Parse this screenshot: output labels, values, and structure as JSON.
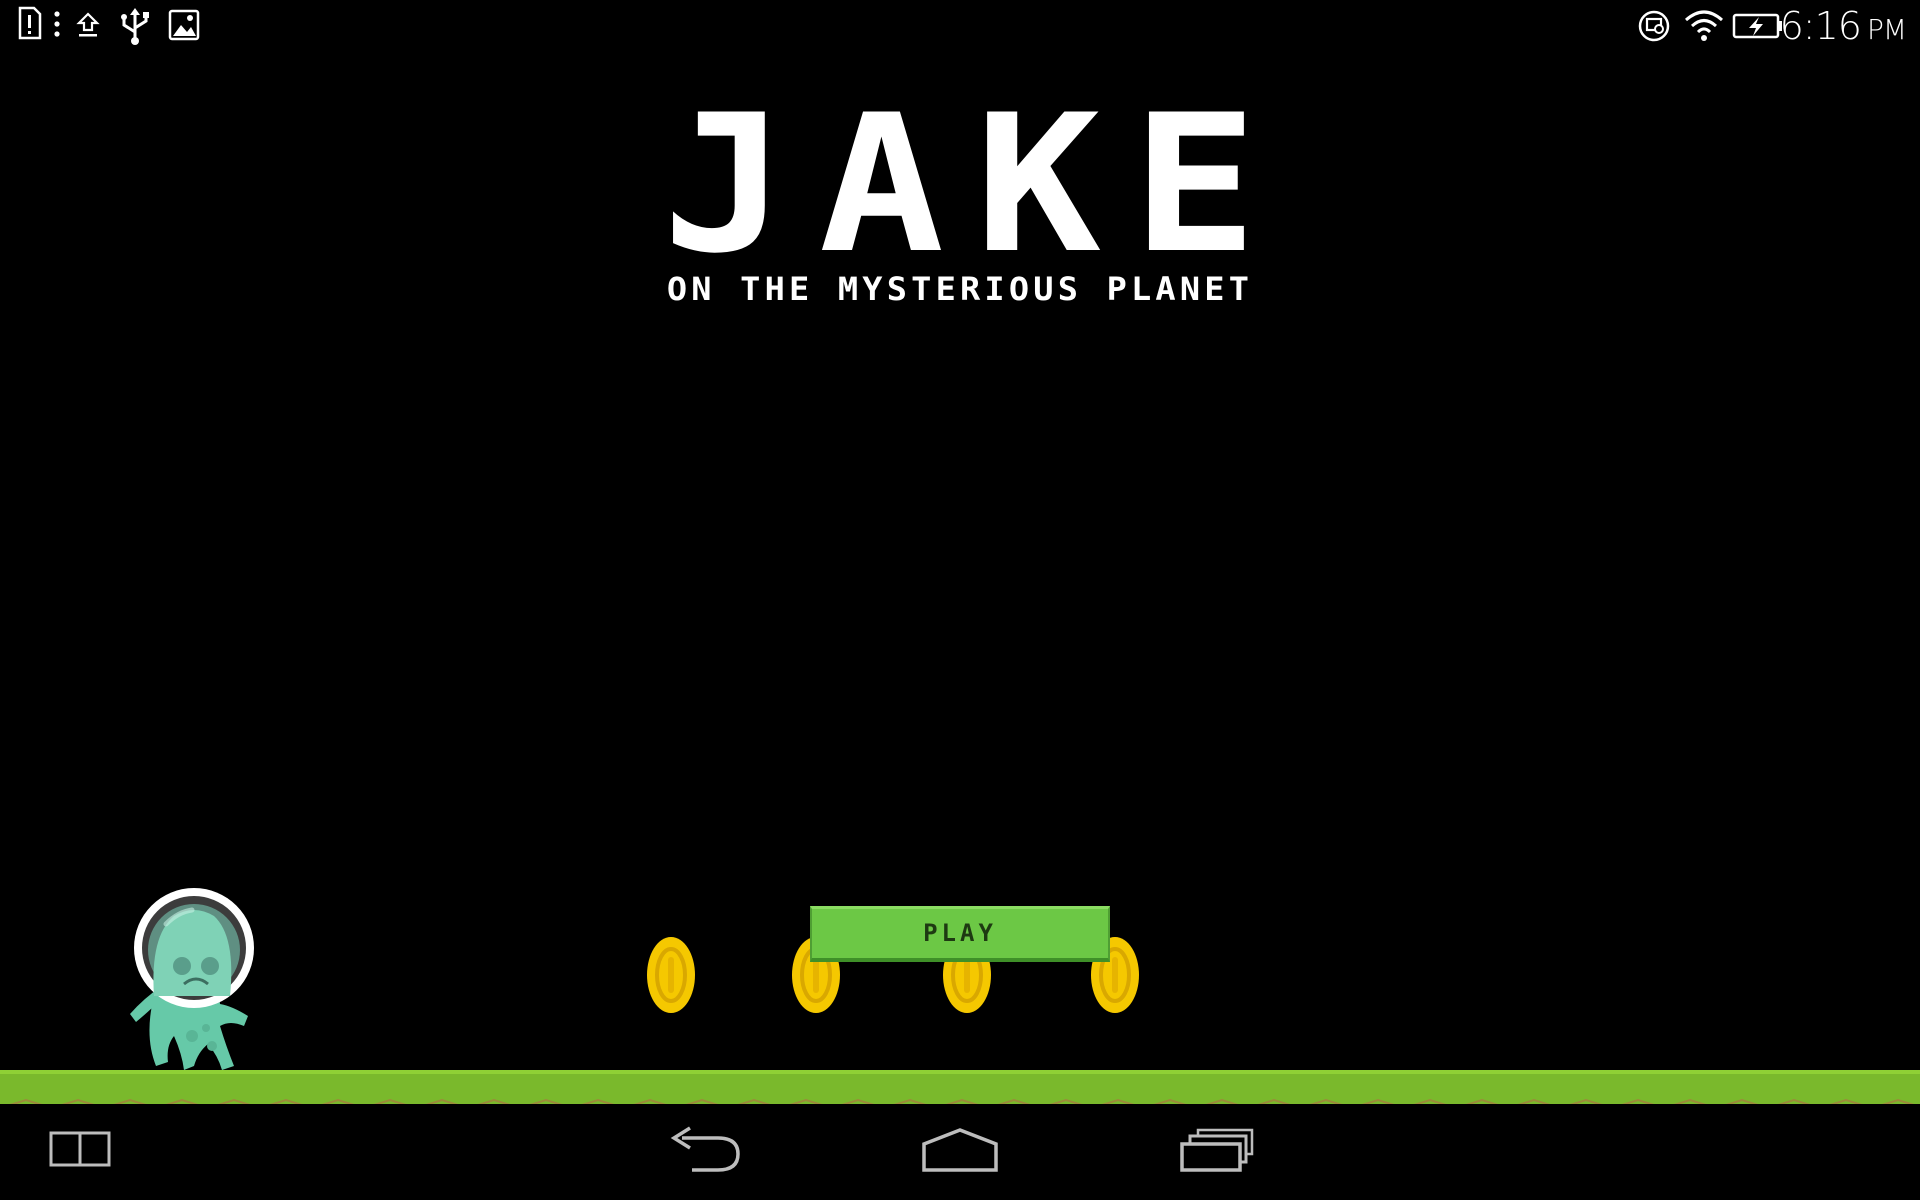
{
  "status_bar": {
    "left_icons": [
      "sim-alert-icon",
      "more-dots-icon",
      "upload-icon",
      "usb-icon",
      "image-icon"
    ],
    "right_icons": [
      "sync-icon",
      "wifi-icon",
      "battery-charging-icon"
    ],
    "time": "6:16",
    "ampm": "PM"
  },
  "game": {
    "title": "JAKE",
    "subtitle": "ON THE MYSTERIOUS PLANET",
    "play_label": "PLAY",
    "coin_count": 4,
    "colors": {
      "ground": "#7ab92c",
      "play_button": "#6cc845",
      "coin": "#f5c800",
      "alien": "#6fcfb0"
    }
  },
  "nav_bar": {
    "buttons": [
      "multiwindow-icon",
      "back-icon",
      "home-icon",
      "recent-apps-icon"
    ]
  }
}
